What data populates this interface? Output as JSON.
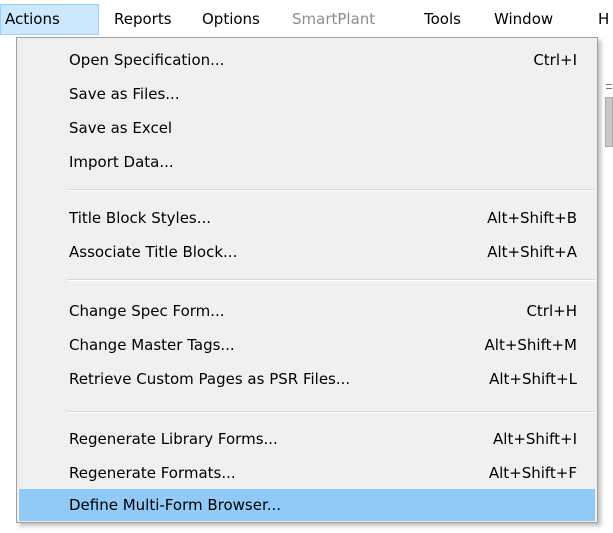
{
  "menubar": {
    "items": [
      {
        "label": "Actions",
        "state": "active"
      },
      {
        "label": "Reports",
        "state": "normal"
      },
      {
        "label": "Options",
        "state": "normal"
      },
      {
        "label": "SmartPlant",
        "state": "disabled"
      },
      {
        "label": "Tools",
        "state": "normal"
      },
      {
        "label": "Window",
        "state": "normal"
      },
      {
        "label": "H",
        "state": "normal"
      }
    ]
  },
  "actions_menu": {
    "items": [
      {
        "label": "Open Specification...",
        "shortcut": "Ctrl+I"
      },
      {
        "label": "Save as Files...",
        "shortcut": ""
      },
      {
        "label": "Save as Excel",
        "shortcut": ""
      },
      {
        "label": "Import Data...",
        "shortcut": ""
      },
      {
        "label": "Title Block Styles...",
        "shortcut": "Alt+Shift+B"
      },
      {
        "label": "Associate Title Block...",
        "shortcut": "Alt+Shift+A"
      },
      {
        "label": "Change Spec Form...",
        "shortcut": "Ctrl+H"
      },
      {
        "label": "Change Master Tags...",
        "shortcut": "Alt+Shift+M"
      },
      {
        "label": "Retrieve Custom Pages as PSR Files...",
        "shortcut": "Alt+Shift+L"
      },
      {
        "label": "Regenerate Library Forms...",
        "shortcut": "Alt+Shift+I"
      },
      {
        "label": "Regenerate Formats...",
        "shortcut": "Alt+Shift+F"
      },
      {
        "label": "Define Multi-Form Browser...",
        "shortcut": "",
        "highlighted": true
      }
    ]
  },
  "colors": {
    "menu_background": "#f0f0f0",
    "highlight": "#91c9f7",
    "menubar_active": "#cce8ff",
    "disabled_text": "#8d8d8d"
  }
}
